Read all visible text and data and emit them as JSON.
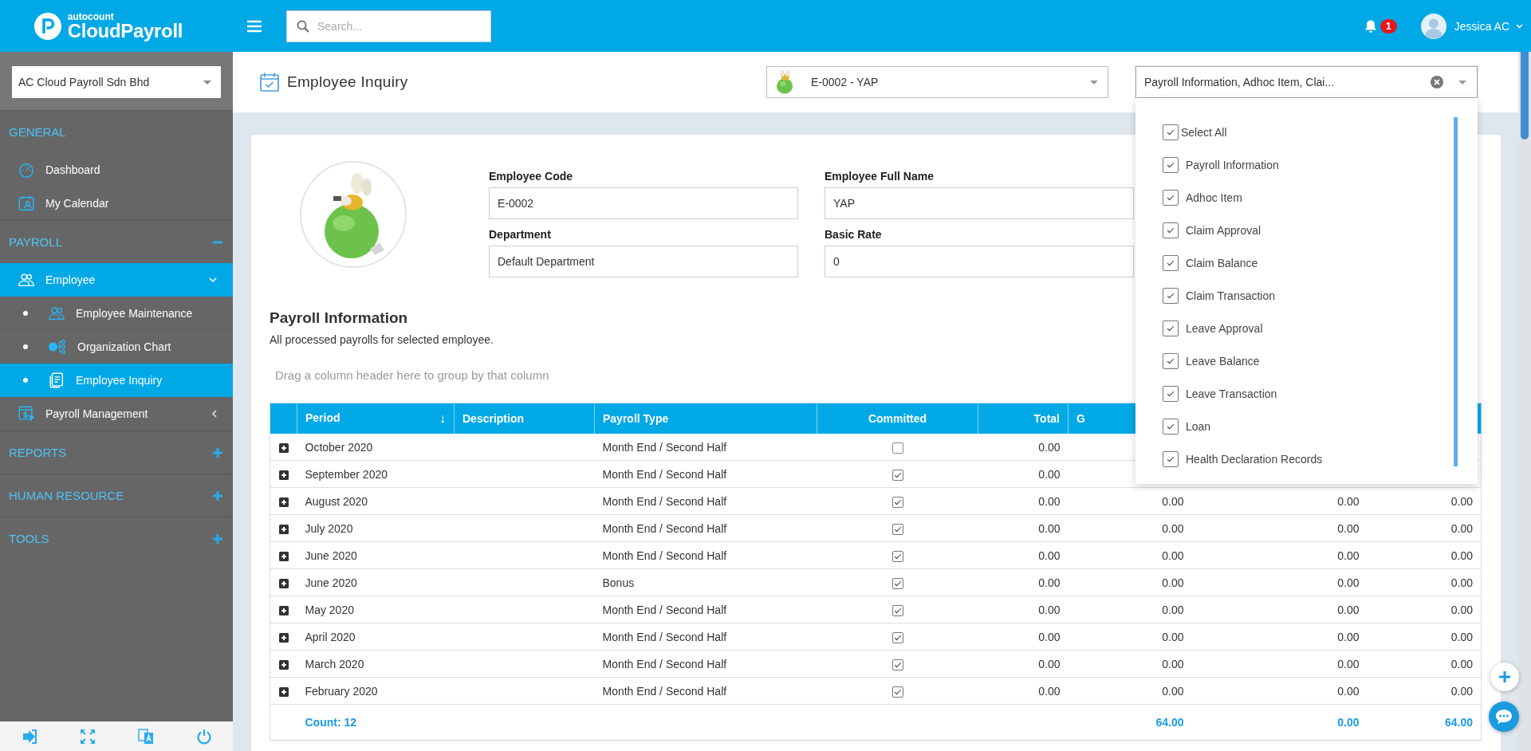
{
  "header": {
    "brand_small": "autocount",
    "brand": "CloudPayroll",
    "search": {
      "placeholder": "Search..."
    },
    "notifications": {
      "count": "1"
    },
    "user": {
      "name": "Jessica AC"
    }
  },
  "sidebar": {
    "company": "AC Cloud Payroll Sdn Bhd",
    "sections": [
      {
        "title": "GENERAL",
        "items": [
          {
            "label": "Dashboard",
            "selected": false
          },
          {
            "label": "My Calendar",
            "selected": false
          }
        ]
      },
      {
        "title": "PAYROLL",
        "expanded": true,
        "items": [
          {
            "label": "Employee",
            "selected": true,
            "expanded": true,
            "children": [
              {
                "label": "Employee Maintenance",
                "selected": false
              },
              {
                "label": "Organization Chart",
                "selected": false
              },
              {
                "label": "Employee Inquiry",
                "selected": true
              }
            ]
          },
          {
            "label": "Payroll Management",
            "selected": false,
            "expanded": false
          }
        ]
      },
      {
        "title": "REPORTS",
        "expanded": false
      },
      {
        "title": "HUMAN RESOURCE",
        "expanded": false
      },
      {
        "title": "TOOLS",
        "expanded": false
      }
    ]
  },
  "page": {
    "title": "Employee Inquiry",
    "employee_select": {
      "value": "E-0002 - YAP"
    },
    "module_select": {
      "value": "Payroll Information, Adhoc Item, Clai...",
      "open": true,
      "options": [
        {
          "label": "Select All",
          "checked": true
        },
        {
          "label": "Payroll Information",
          "checked": true
        },
        {
          "label": "Adhoc Item",
          "checked": true
        },
        {
          "label": "Claim Approval",
          "checked": true
        },
        {
          "label": "Claim Balance",
          "checked": true
        },
        {
          "label": "Claim Transaction",
          "checked": true
        },
        {
          "label": "Leave Approval",
          "checked": true
        },
        {
          "label": "Leave Balance",
          "checked": true
        },
        {
          "label": "Leave Transaction",
          "checked": true
        },
        {
          "label": "Loan",
          "checked": true
        },
        {
          "label": "Health Declaration Records",
          "checked": true
        }
      ]
    },
    "profile": {
      "fields": [
        {
          "label": "Employee Code",
          "value": "E-0002"
        },
        {
          "label": "Employee Full Name",
          "value": "YAP"
        },
        {
          "label": "Department",
          "value": "Default Department"
        },
        {
          "label": "Basic Rate",
          "value": "0"
        }
      ]
    },
    "payroll": {
      "title": "Payroll Information",
      "subtitle": "All processed payrolls for selected employee.",
      "group_hint": "Drag a column header here to group by that column",
      "table": {
        "columns": [
          {
            "label": "Period",
            "sort_mark": "↓"
          },
          {
            "label": "Description"
          },
          {
            "label": "Payroll Type"
          },
          {
            "label": "Committed"
          },
          {
            "label": "Total"
          },
          {
            "label": "G"
          }
        ],
        "rows": [
          {
            "expanded": false,
            "period": "October 2020",
            "payroll_type": "Month End / Second Half",
            "committed": false,
            "total": "0.00"
          },
          {
            "expanded": false,
            "period": "September 2020",
            "payroll_type": "Month End / Second Half",
            "committed": true,
            "total": "0.00"
          },
          {
            "expanded": false,
            "period": "August 2020",
            "payroll_type": "Month End / Second Half",
            "committed": true,
            "total": "0.00",
            "more": [
              "0.00",
              "0.00",
              "0.00"
            ]
          },
          {
            "expanded": false,
            "period": "July 2020",
            "payroll_type": "Month End / Second Half",
            "committed": true,
            "total": "0.00",
            "more": [
              "0.00",
              "0.00",
              "0.00"
            ]
          },
          {
            "expanded": false,
            "period": "June 2020",
            "payroll_type": "Month End / Second Half",
            "committed": true,
            "total": "0.00",
            "more": [
              "0.00",
              "0.00",
              "0.00"
            ]
          },
          {
            "expanded": false,
            "period": "June 2020",
            "payroll_type": "Bonus",
            "committed": true,
            "total": "0.00",
            "more": [
              "0.00",
              "0.00",
              "0.00"
            ]
          },
          {
            "expanded": false,
            "period": "May 2020",
            "payroll_type": "Month End / Second Half",
            "committed": true,
            "total": "0.00",
            "more": [
              "0.00",
              "0.00",
              "0.00"
            ]
          },
          {
            "expanded": false,
            "period": "April 2020",
            "payroll_type": "Month End / Second Half",
            "committed": true,
            "total": "0.00",
            "more": [
              "0.00",
              "0.00",
              "0.00"
            ]
          },
          {
            "expanded": false,
            "period": "March 2020",
            "payroll_type": "Month End / Second Half",
            "committed": true,
            "total": "0.00",
            "more": [
              "0.00",
              "0.00",
              "0.00"
            ]
          },
          {
            "expanded": false,
            "period": "February 2020",
            "payroll_type": "Month End / Second Half",
            "committed": true,
            "total": "0.00",
            "more": [
              "0.00",
              "0.00",
              "0.00"
            ]
          }
        ],
        "footer": {
          "count": "Count: 12",
          "totals": [
            "64.00",
            "0.00",
            "64.00"
          ]
        }
      }
    }
  }
}
